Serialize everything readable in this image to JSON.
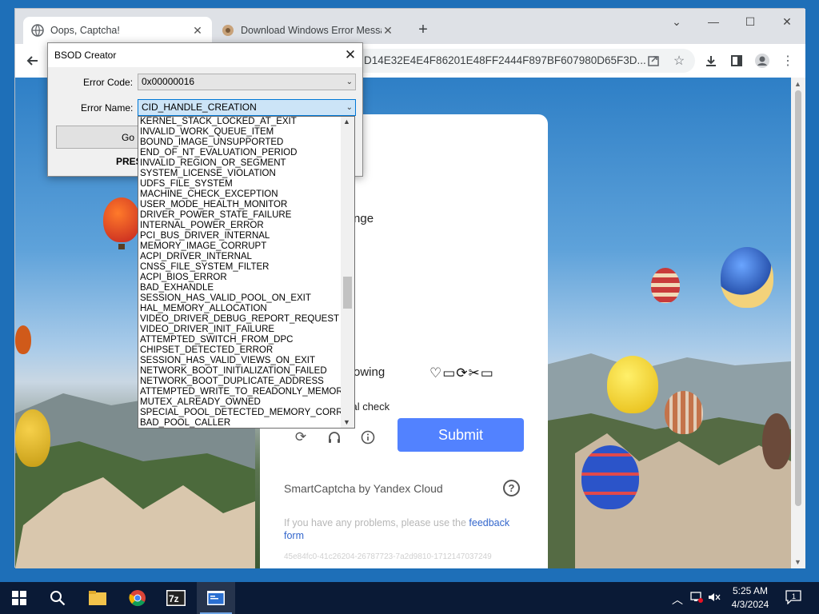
{
  "browser": {
    "tabs": [
      {
        "title": "Oops, Captcha!",
        "active": true
      },
      {
        "title": "Download Windows Error Messa",
        "active": false
      }
    ],
    "address_text": "D14E32E4E4F86201E48FF2444F897BF607980D65F3D..."
  },
  "captcha": {
    "challenge_text": "llenge",
    "following_text": "ollowing",
    "glyphs": "♡▭⟳✂▭",
    "additional_check": "onal check",
    "submit_label": "Submit",
    "brand": "SmartCaptcha by Yandex Cloud",
    "help": "?",
    "problem_text": "If you have any problems, please use the",
    "feedback_link_a": "feedback",
    "feedback_link_b": "form",
    "request_id": "45e84fc0-41c26204-26787723-7a2d9810-1712147037249"
  },
  "bsod_dialog": {
    "title": "BSOD Creator",
    "error_code_label": "Error Code:",
    "error_code_value": "0x00000016",
    "error_name_label": "Error Name:",
    "error_name_value": "CID_HANDLE_CREATION",
    "go_label": "Go",
    "press_text": "PRES"
  },
  "dropdown_items": [
    "KERNEL_STACK_LOCKED_AT_EXIT",
    "INVALID_WORK_QUEUE_ITEM",
    "BOUND_IMAGE_UNSUPPORTED",
    "END_OF_NT_EVALUATION_PERIOD",
    "INVALID_REGION_OR_SEGMENT",
    "SYSTEM_LICENSE_VIOLATION",
    "UDFS_FILE_SYSTEM",
    "MACHINE_CHECK_EXCEPTION",
    "USER_MODE_HEALTH_MONITOR",
    "DRIVER_POWER_STATE_FAILURE",
    "INTERNAL_POWER_ERROR",
    "PCI_BUS_DRIVER_INTERNAL",
    "MEMORY_IMAGE_CORRUPT",
    "ACPI_DRIVER_INTERNAL",
    "CNSS_FILE_SYSTEM_FILTER",
    "ACPI_BIOS_ERROR",
    "BAD_EXHANDLE",
    "SESSION_HAS_VALID_POOL_ON_EXIT",
    "HAL_MEMORY_ALLOCATION",
    "VIDEO_DRIVER_DEBUG_REPORT_REQUEST",
    "VIDEO_DRIVER_INIT_FAILURE",
    "ATTEMPTED_SWITCH_FROM_DPC",
    "CHIPSET_DETECTED_ERROR",
    "SESSION_HAS_VALID_VIEWS_ON_EXIT",
    "NETWORK_BOOT_INITIALIZATION_FAILED",
    "NETWORK_BOOT_DUPLICATE_ADDRESS",
    "ATTEMPTED_WRITE_TO_READONLY_MEMORY",
    "MUTEX_ALREADY_OWNED",
    "SPECIAL_POOL_DETECTED_MEMORY_CORRUPTION",
    "BAD_POOL_CALLER"
  ],
  "taskbar": {
    "time": "5:25 AM",
    "date": "4/3/2024",
    "notification_count": "1"
  }
}
